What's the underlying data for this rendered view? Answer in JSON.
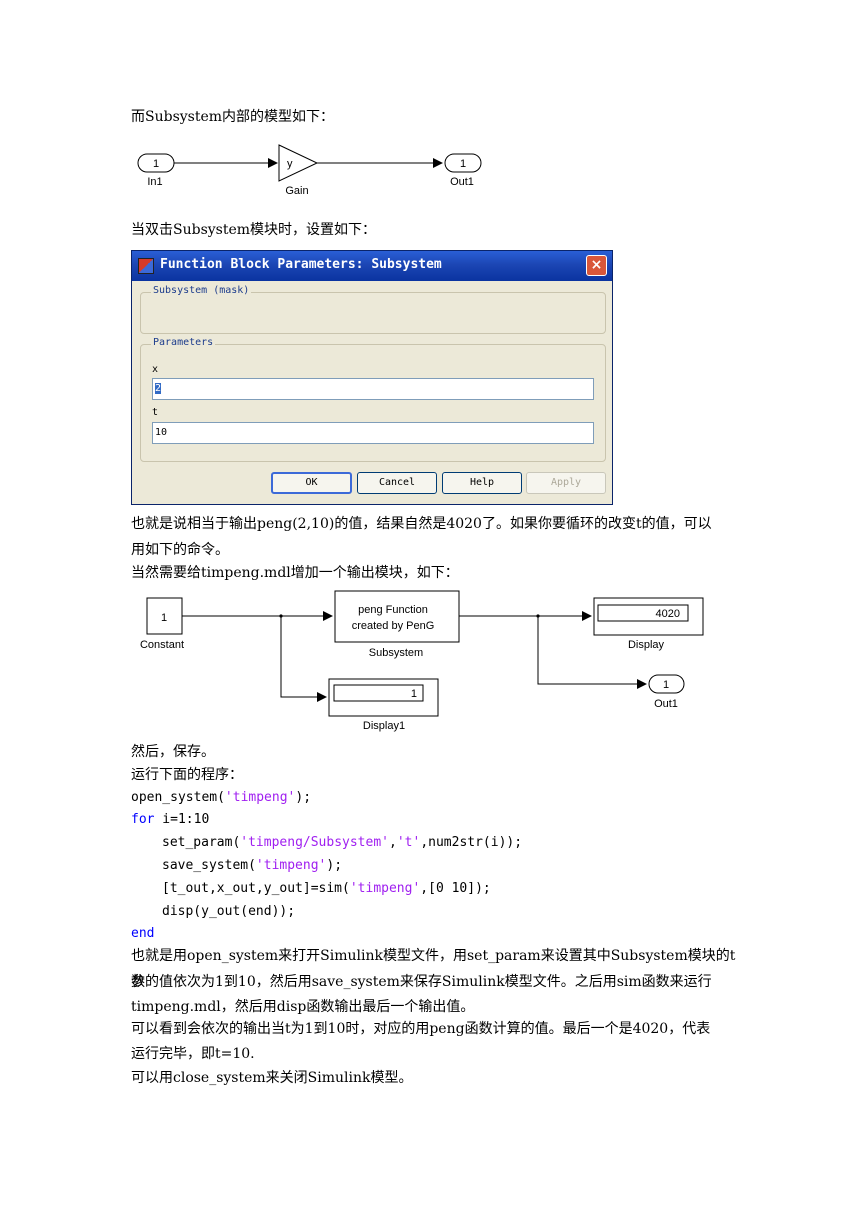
{
  "paragraphs": {
    "p1": "而Subsystem内部的模型如下：",
    "p2": "当双击Subsystem模块时，设置如下：",
    "p3_line1": "也就是说相当于输出peng(2,10)的值，结果自然是4020了。如果你要循环的改变t的值，可以",
    "p3_line2": "用如下的命令。",
    "p4": "当然需要给timpeng.mdl增加一个输出模块，如下：",
    "p5": "然后，保存。",
    "p6": "运行下面的程序：",
    "p7_line1": "也就是用open_system来打开Simulink模型文件，用set_param来设置其中Subsystem模块的t参",
    "p7_line2": "数的值依次为1到10，然后用save_system来保存Simulink模型文件。之后用sim函数来运行",
    "p7_line3": "timpeng.mdl，然后用disp函数输出最后一个输出值。",
    "p8_line1": "可以看到会依次的输出当t为1到10时，对应的用peng函数计算的值。最后一个是4020，代表",
    "p8_line2": "运行完毕，即t=10.",
    "p9": "可以用close_system来关闭Simulink模型。"
  },
  "diagram1": {
    "in_port_num": "1",
    "in_port_label": "In1",
    "gain_symbol": "y",
    "gain_label": "Gain",
    "out_port_num": "1",
    "out_port_label": "Out1"
  },
  "dialog": {
    "title": "Function Block Parameters: Subsystem",
    "close_symbol": "×",
    "group1_legend": "Subsystem (mask)",
    "group2_legend": "Parameters",
    "param1_label": "x",
    "param1_value": "2",
    "param2_label": "t",
    "param2_value": "10",
    "buttons": {
      "ok": "OK",
      "cancel": "Cancel",
      "help": "Help",
      "apply": "Apply"
    }
  },
  "diagram2": {
    "constant_value": "1",
    "constant_label": "Constant",
    "subsystem_line1": "peng Function",
    "subsystem_line2": "created by PenG",
    "subsystem_label": "Subsystem",
    "display_value": "4020",
    "display_label": "Display",
    "display1_value": "1",
    "display1_label": "Display1",
    "out_port_num": "1",
    "out_port_label": "Out1"
  },
  "code": {
    "l1_fn": "open_system(",
    "l1_str": "'timpeng'",
    "l1_end": ");",
    "l2_kw": "for",
    "l2_rest": " i=1:10",
    "l3_a": "set_param(",
    "l3_s1": "'timpeng/Subsystem'",
    "l3_b": ",",
    "l3_s2": "'t'",
    "l3_c": ",num2str(i));",
    "l4_a": "save_system(",
    "l4_s": "'timpeng'",
    "l4_b": ");",
    "l5_a": "[t_out,x_out,y_out]=sim(",
    "l5_s": "'timpeng'",
    "l5_b": ",[0 10]);",
    "l6": "disp(y_out(end));",
    "l7_kw": "end"
  }
}
